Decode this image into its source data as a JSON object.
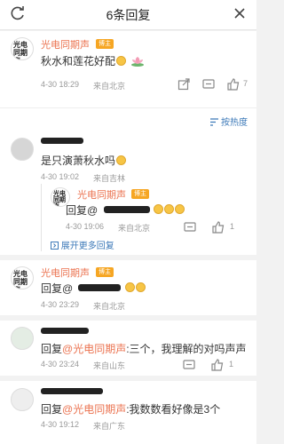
{
  "header": {
    "title": "6条回复"
  },
  "post": {
    "author": "光电同期声",
    "badge": "博主",
    "text": "秋水和莲花好配",
    "time": "4-30 18:29",
    "location": "来自北京",
    "like_count": "7"
  },
  "sort": {
    "label": "按热度"
  },
  "replies": [
    {
      "text": "是只演萧秋水吗",
      "time": "4-30 19:02",
      "location": "来自吉林",
      "nested": {
        "author": "光电同期声",
        "badge": "博主",
        "prefix": "回复@",
        "time": "4-30 19:06",
        "location": "来自北京",
        "like_count": "1"
      },
      "expand_label": "展开更多回复"
    },
    {
      "author": "光电同期声",
      "badge": "博主",
      "prefix": "回复@",
      "time": "4-30 23:29",
      "location": "来自北京"
    },
    {
      "prefix": "回复",
      "mention": "@光电同期声",
      "text": ":三个，我理解的对吗声声",
      "time": "4-30 23:24",
      "location": "来自山东",
      "like_count": "1"
    },
    {
      "prefix": "回复",
      "mention": "@光电同期声",
      "text": ":我数数看好像是3个",
      "time": "4-30 19:12",
      "location": "来自广东"
    }
  ],
  "icons": {
    "share": "share-icon",
    "comment": "comment-icon",
    "like": "thumbs-up-icon",
    "refresh": "refresh-icon",
    "close": "close-icon",
    "sort": "sort-icon"
  },
  "colors": {
    "accent": "#eb7350",
    "link": "#3c79b8",
    "meta": "#999999"
  }
}
